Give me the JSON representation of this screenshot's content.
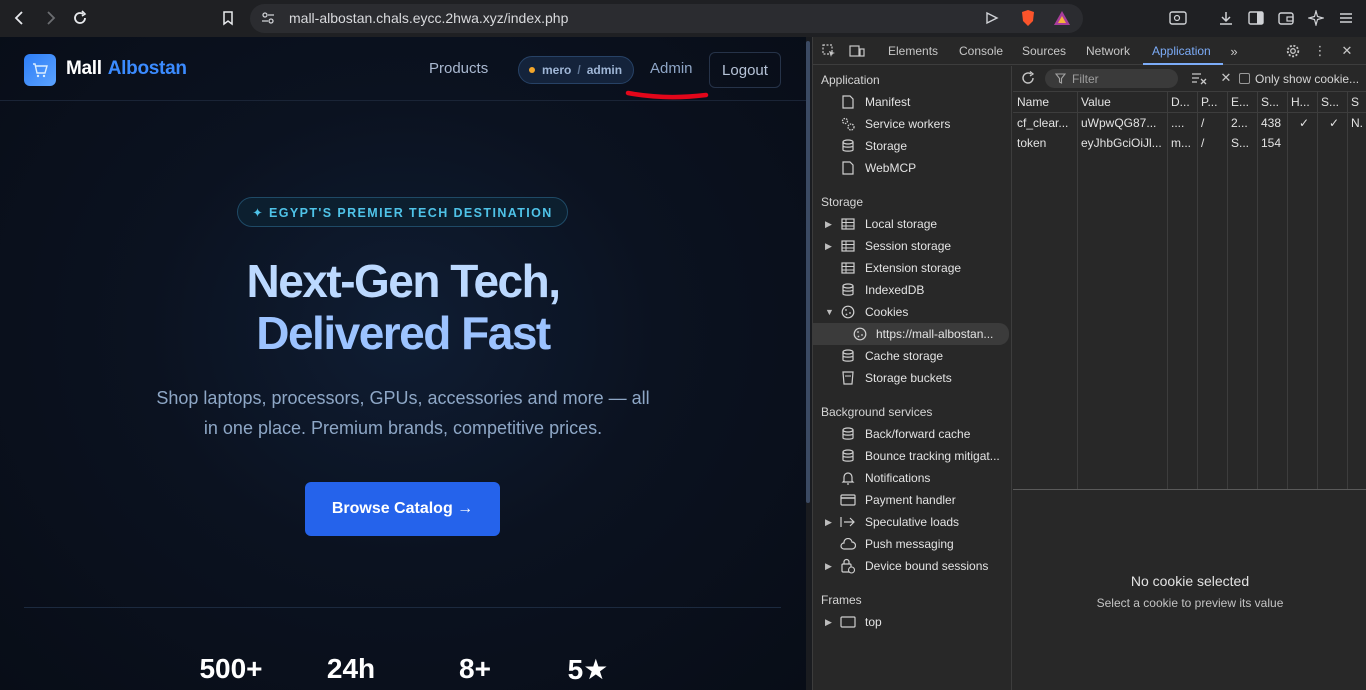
{
  "browser": {
    "url": "mall-albostan.chals.eycc.2hwa.xyz/index.php"
  },
  "site": {
    "logo_icon": "cart-icon",
    "brand_main": "Mall",
    "brand_accent": "Albostan",
    "nav_products": "Products",
    "user_name": "mero",
    "user_sep": "/",
    "user_role": "admin",
    "nav_admin": "Admin",
    "logout": "Logout",
    "badge": "✦ EGYPT'S PREMIER TECH DESTINATION",
    "title_line1": "Next-Gen Tech,",
    "title_line2": "Delivered Fast",
    "subtitle": "Shop laptops, processors, GPUs, accessories and more — all in one place. Premium brands, competitive prices.",
    "cta": "Browse Catalog →",
    "stats": [
      "500+",
      "24h",
      "8+",
      "5★"
    ]
  },
  "devtools": {
    "tabs": [
      "Elements",
      "Console",
      "Sources",
      "Network",
      "Application"
    ],
    "active_tab": "Application",
    "sidebar": {
      "application_heading": "Application",
      "application_items": [
        "Manifest",
        "Service workers",
        "Storage",
        "WebMCP"
      ],
      "storage_heading": "Storage",
      "storage_items": [
        "Local storage",
        "Session storage",
        "Extension storage",
        "IndexedDB",
        "Cookies",
        "https://mall-albostan...",
        "Cache storage",
        "Storage buckets"
      ],
      "background_heading": "Background services",
      "background_items": [
        "Back/forward cache",
        "Bounce tracking mitigat...",
        "Notifications",
        "Payment handler",
        "Speculative loads",
        "Push messaging",
        "Device bound sessions"
      ],
      "frames_heading": "Frames",
      "frames_items": [
        "top"
      ]
    },
    "toolbar": {
      "filter_placeholder": "Filter",
      "only_show": "Only show cookie..."
    },
    "table": {
      "headers": [
        "Name",
        "Value",
        "D...",
        "P...",
        "E...",
        "S...",
        "H...",
        "S...",
        "S"
      ],
      "rows": [
        [
          "cf_clear...",
          "uWpwQG87...",
          "....",
          "/",
          "2...",
          "438",
          "✓",
          "✓",
          "N."
        ],
        [
          "token",
          "eyJhbGciOiJl...",
          "m...",
          "/",
          "S...",
          "154",
          "",
          "",
          ""
        ]
      ]
    },
    "preview": {
      "title": "No cookie selected",
      "subtitle": "Select a cookie to preview its value"
    }
  }
}
